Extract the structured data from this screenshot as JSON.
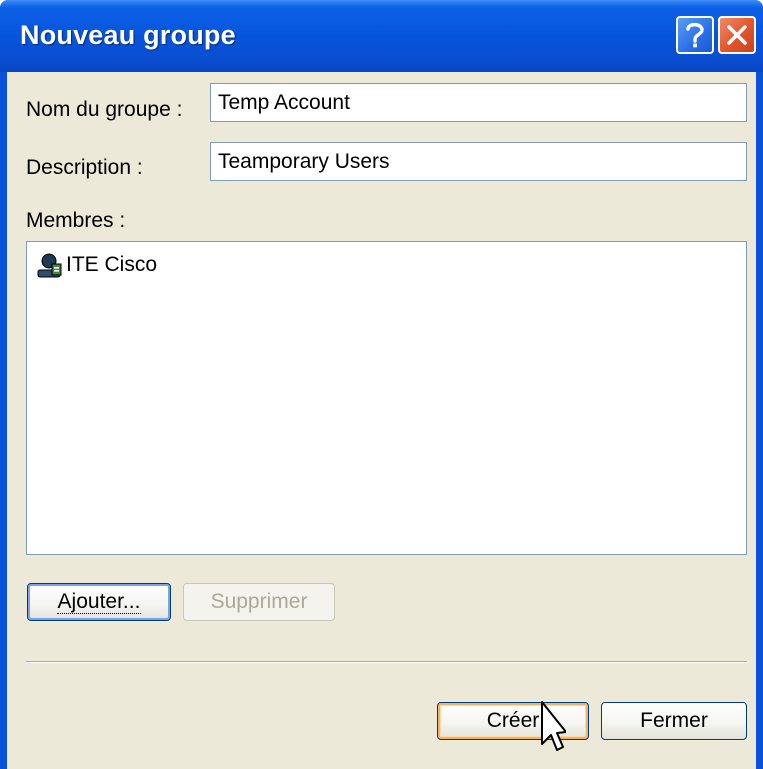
{
  "window": {
    "title": "Nouveau groupe",
    "help_icon": "help-question-icon",
    "close_icon": "close-x-icon"
  },
  "form": {
    "name_label": "Nom du groupe :",
    "name_value": "Temp Account",
    "description_label": "Description :",
    "description_value": "Teamporary Users",
    "members_label": "Membres :"
  },
  "members": {
    "items": [
      {
        "name": "ITE Cisco",
        "icon": "user-icon"
      }
    ]
  },
  "buttons": {
    "add_label": "Ajouter...",
    "remove_label": "Supprimer",
    "create_label": "Créer",
    "close_label": "Fermer"
  },
  "colors": {
    "titlebar": "#0654dc",
    "dialog_background": "#ece9d8",
    "field_border": "#7f9db9",
    "close_button": "#e2542c"
  }
}
